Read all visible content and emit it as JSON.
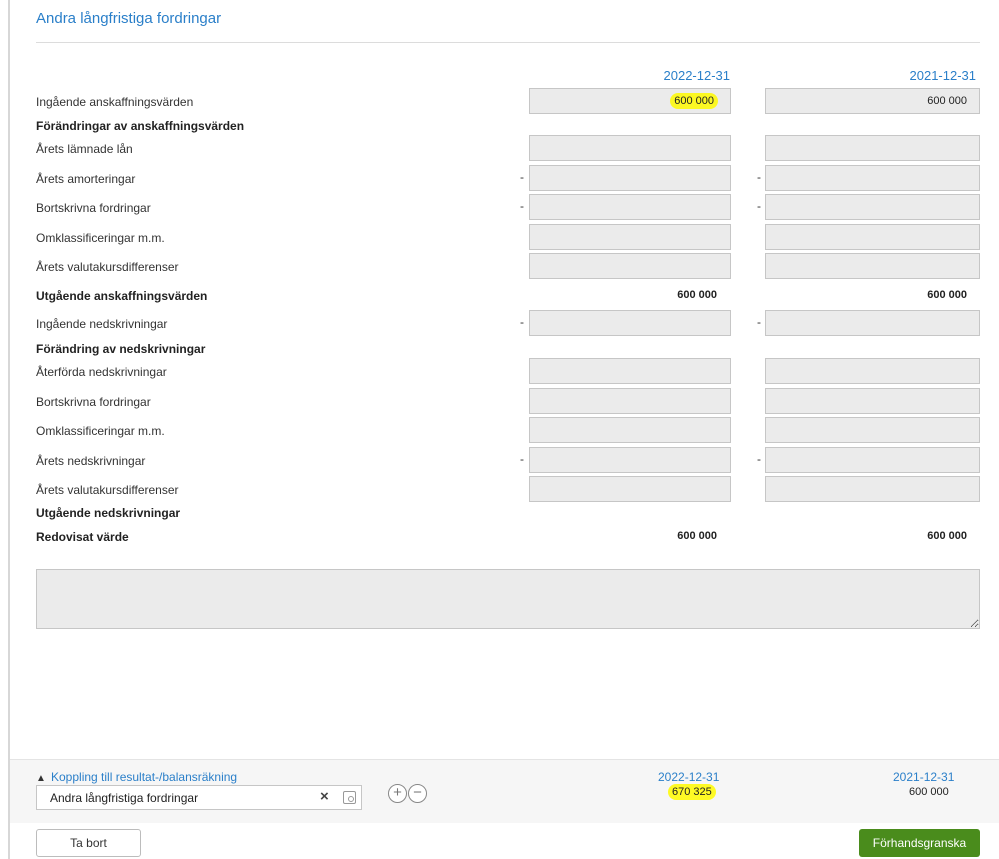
{
  "title": "Andra långfristiga fordringar",
  "columns": {
    "col1": "2022-12-31",
    "col2": "2021-12-31"
  },
  "rows": [
    {
      "label": "Ingående anskaffningsvärden",
      "type": "input",
      "c1": "600 000",
      "c2": "600 000",
      "minus": false
    },
    {
      "label": "Förändringar av anskaffningsvärden",
      "type": "heading"
    },
    {
      "label": "Årets lämnade lån",
      "type": "input",
      "c1": "",
      "c2": "",
      "minus": false
    },
    {
      "label": "Årets amorteringar",
      "type": "input",
      "c1": "",
      "c2": "",
      "minus": true
    },
    {
      "label": "Bortskrivna fordringar",
      "type": "input",
      "c1": "",
      "c2": "",
      "minus": true
    },
    {
      "label": "Omklassificeringar m.m.",
      "type": "input",
      "c1": "",
      "c2": "",
      "minus": false
    },
    {
      "label": "Årets valutakursdifferenser",
      "type": "input",
      "c1": "",
      "c2": "",
      "minus": false
    },
    {
      "label": "Utgående anskaffningsvärden",
      "type": "total",
      "c1": "600 000",
      "c2": "600 000"
    },
    {
      "label": "Ingående nedskrivningar",
      "type": "input",
      "c1": "",
      "c2": "",
      "minus": true
    },
    {
      "label": "Förändring av nedskrivningar",
      "type": "heading"
    },
    {
      "label": "Återförda nedskrivningar",
      "type": "input",
      "c1": "",
      "c2": "",
      "minus": false
    },
    {
      "label": "Bortskrivna fordringar",
      "type": "input",
      "c1": "",
      "c2": "",
      "minus": false
    },
    {
      "label": "Omklassificeringar m.m.",
      "type": "input",
      "c1": "",
      "c2": "",
      "minus": false
    },
    {
      "label": "Årets nedskrivningar",
      "type": "input",
      "c1": "",
      "c2": "",
      "minus": true
    },
    {
      "label": "Årets valutakursdifferenser",
      "type": "input",
      "c1": "",
      "c2": "",
      "minus": false
    },
    {
      "label": "Utgående nedskrivningar",
      "type": "heading"
    },
    {
      "label": "Redovisat värde",
      "type": "total",
      "c1": "600 000",
      "c2": "600 000"
    }
  ],
  "minus_sign": "-",
  "notes_value": "",
  "footer": {
    "link_label": "Koppling till resultat-/balansräkning",
    "account_value": "Andra långfristiga fordringar",
    "clear_icon": "×",
    "add_icon": "+",
    "remove_icon": "−",
    "col1_date": "2022-12-31",
    "col1_value": "670 325",
    "col2_date": "2021-12-31",
    "col2_value": "600 000"
  },
  "buttons": {
    "delete": "Ta bort",
    "preview": "Förhandsgranska"
  },
  "colors": {
    "accent": "#2a7fc9",
    "primary_button": "#4a8c1c",
    "highlight": "#fff200"
  }
}
